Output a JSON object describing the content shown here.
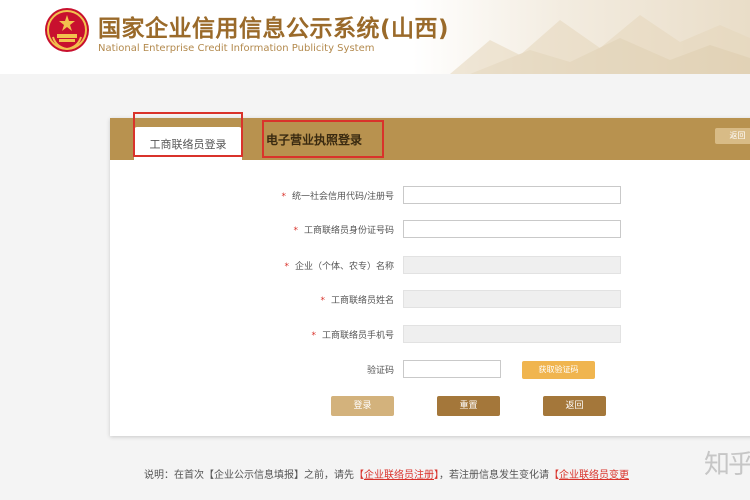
{
  "header": {
    "title_cn": "国家企业信用信息公示系统(山西)",
    "title_en": "National Enterprise Credit Information Publicity System"
  },
  "tabs": {
    "active_label": "工商联络员登录",
    "inactive_label": "电子营业执照登录",
    "return_chip": "返回"
  },
  "form": {
    "fields": [
      {
        "label": "统一社会信用代码/注册号",
        "value": "",
        "required": true
      },
      {
        "label": "工商联络员身份证号码",
        "value": "",
        "required": true
      },
      {
        "label": "企业（个体、农专）名称",
        "value": "",
        "required": true
      },
      {
        "label": "工商联络员姓名",
        "value": "",
        "required": true
      },
      {
        "label": "工商联络员手机号",
        "value": "",
        "required": true
      }
    ],
    "captcha_label": "验证码",
    "captcha_value": "",
    "captcha_button": "获取验证码",
    "required_mark": "*"
  },
  "buttons": {
    "login": "登录",
    "reset": "重置",
    "back": "返回"
  },
  "note": {
    "prefix": "说明：在首次【企业公示信息填报】之前，请先",
    "bracket_open": "【",
    "link1": "企业联络员注册",
    "bracket_close": "】",
    "middle": "，若注册信息发生变化请",
    "link2": "企业联络员变更"
  },
  "watermark": "知乎",
  "colors": {
    "brand_gold": "#b8924f",
    "title_brown": "#9a6a2a",
    "highlight_red": "#d9332b",
    "captcha_orange": "#f0b54f"
  }
}
